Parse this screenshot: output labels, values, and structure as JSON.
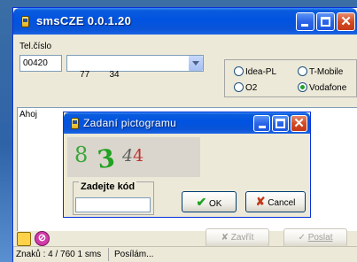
{
  "window": {
    "title": "smsCZE 0.0.1.20"
  },
  "form": {
    "phone_label": "Tel.číslo",
    "prefix_value": "00420",
    "number_value": "77        34",
    "operators": [
      {
        "label": "Idea-PL",
        "checked": false
      },
      {
        "label": "T-Mobile",
        "checked": false
      },
      {
        "label": "O2",
        "checked": false
      },
      {
        "label": "Vodafone",
        "checked": true
      }
    ]
  },
  "message": {
    "text": "Ahoj"
  },
  "dialog": {
    "title": "Zadaní pictogramu",
    "captcha": [
      "8",
      "3",
      "4",
      "4"
    ],
    "code_label": "Zadejte kód",
    "code_value": "",
    "ok_label": "OK",
    "cancel_label": "Cancel"
  },
  "bottom": {
    "close_label": "Zavřít",
    "send_label": "Poslat"
  },
  "status": {
    "counter": "Znaků : 4 / 760  1 sms",
    "state": "Posílám..."
  },
  "colors": {
    "accent": "#0a54d7",
    "ok_green": "#21a121",
    "cancel_red": "#c4391b"
  }
}
